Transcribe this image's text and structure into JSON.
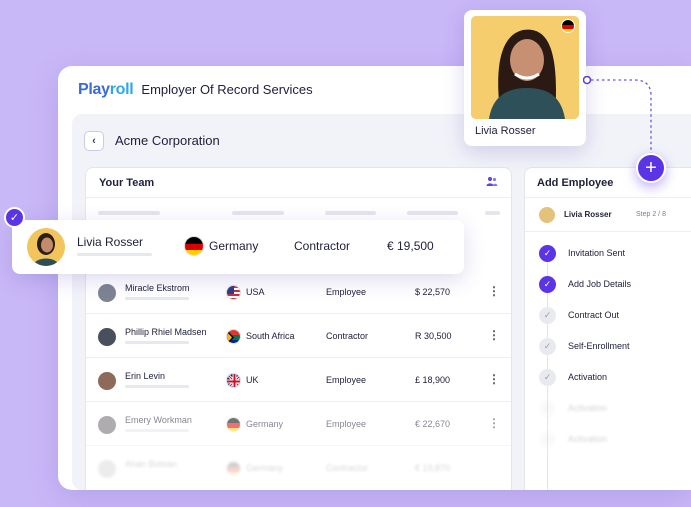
{
  "brand": {
    "logo_part1": "Play",
    "logo_part2": "roll",
    "title": "Employer Of Record Services"
  },
  "company": "Acme Corporation",
  "team": {
    "title": "Your Team",
    "rows": [
      {
        "name": "Miracle Ekstrom",
        "country": "USA",
        "type": "Employee",
        "salary": "$ 22,570"
      },
      {
        "name": "Phillip Rhiel Madsen",
        "country": "South Africa",
        "type": "Contractor",
        "salary": "R 30,500"
      },
      {
        "name": "Erin Levin",
        "country": "UK",
        "type": "Employee",
        "salary": "£ 18,900"
      },
      {
        "name": "Emery Workman",
        "country": "Germany",
        "type": "Employee",
        "salary": "€ 22,670"
      },
      {
        "name": "Ahan Botoan",
        "country": "Germany",
        "type": "Contractor",
        "salary": "€ 19,870"
      }
    ],
    "more_symbol": "⋮"
  },
  "featured": {
    "name": "Livia Rosser",
    "country": "Germany",
    "type": "Contractor",
    "salary": "€ 19,500"
  },
  "add_employee": {
    "title": "Add Employee",
    "employee_name": "Livia Rosser",
    "step": "Step 2 / 8",
    "steps": [
      {
        "label": "Invitation Sent",
        "status": "done"
      },
      {
        "label": "Add Job Details",
        "status": "done"
      },
      {
        "label": "Contract Out",
        "status": "todo"
      },
      {
        "label": "Self-Enrollment",
        "status": "todo"
      },
      {
        "label": "Activation",
        "status": "todo"
      },
      {
        "label": "Activation",
        "status": "hidden"
      },
      {
        "label": "Activation",
        "status": "hidden"
      }
    ]
  },
  "profile": {
    "name": "Livia Rosser"
  },
  "icons": {
    "back": "chevron-left-icon",
    "team": "people-icon",
    "check": "check-icon",
    "add": "plus-icon"
  },
  "colors": {
    "accent": "#5b35e5",
    "background": "#c9b8f7",
    "logo_blue": "#3a6ad8",
    "logo_cyan": "#30a7ea"
  }
}
